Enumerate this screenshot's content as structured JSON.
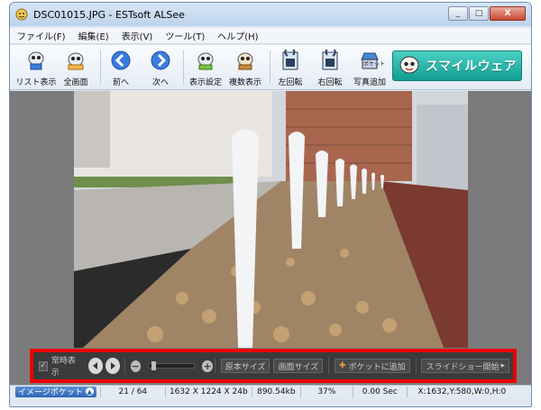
{
  "window": {
    "title": "DSC01015.JPG - ESTsoft ALSee",
    "buttons": {
      "minimize": "_",
      "maximize": "□",
      "close": "X"
    }
  },
  "menu": [
    "ファイル(F)",
    "編集(E)",
    "表示(V)",
    "ツール(T)",
    "ヘルプ(H)"
  ],
  "toolbar": {
    "list": "リスト表示",
    "fullscreen": "全画面",
    "prev": "前へ",
    "next": "次へ",
    "display_settings": "表示設定",
    "multi_view": "複数表示",
    "rotate_left": "左回転",
    "rotate_right": "右回転",
    "add_photo": "写真追加",
    "add_photo_badge": "ポケット",
    "brand": "スマイルウェア"
  },
  "controls": {
    "always_show": "常時表示",
    "original_size": "原本サイズ",
    "screen_size": "画面サイズ",
    "add_to_pocket": "ポケットに追加",
    "slideshow_start": "スライドショー開始",
    "zoom_level": 0.05
  },
  "status": {
    "pocket": "イメージポケット",
    "index": "21 / 64",
    "dimensions": "1632 X 1224 X 24b",
    "filesize": "890.54kb",
    "zoom": "37%",
    "time": "0.00 Sec",
    "coords": "X:1632,Y:580,W:0,H:0"
  },
  "colors": {
    "accent_brand": "#1aa89b",
    "highlight_frame": "#ee0000"
  }
}
